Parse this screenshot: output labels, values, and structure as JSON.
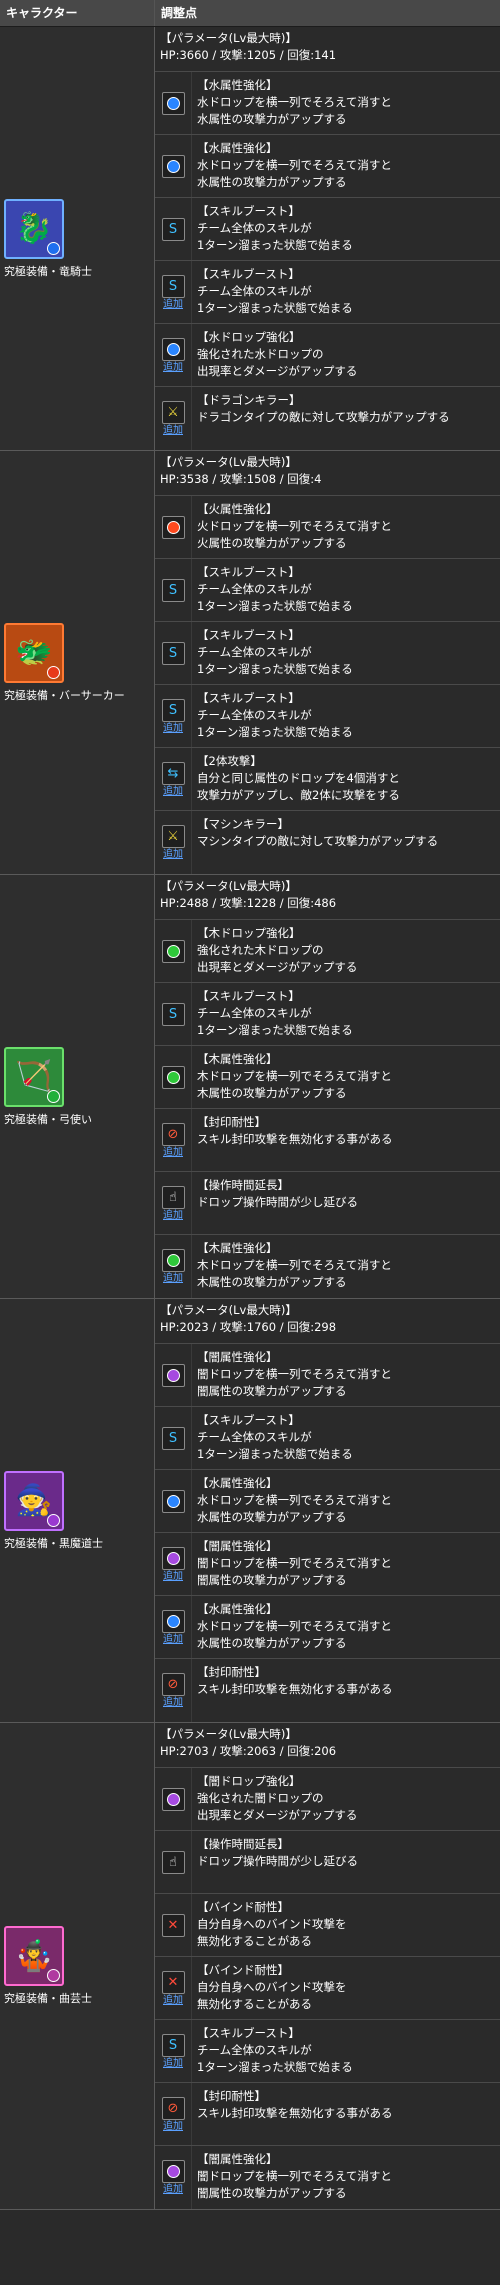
{
  "header": {
    "character_col": "キャラクター",
    "adjust_col": "調整点"
  },
  "add_label": "追加",
  "groups": [
    {
      "name": "究極装備・竜騎士",
      "avatar": {
        "bg": "#3a46b0",
        "border": "#6fb0ff",
        "glyph": "🐉",
        "orb": "#1e6ff0"
      },
      "param": {
        "title": "【パラメータ(Lv最大時)】",
        "stats": "HP:3660 / 攻撃:1205 / 回復:141"
      },
      "rows": [
        {
          "icon": "water-orb-icon",
          "kind": "orb",
          "color": "#2a85ff",
          "added": false,
          "title": "【水属性強化】",
          "lines": [
            "水ドロップを横一列でそろえて消すと",
            "水属性の攻撃力がアップする"
          ]
        },
        {
          "icon": "water-orb-icon",
          "kind": "orb",
          "color": "#2a85ff",
          "added": false,
          "title": "【水属性強化】",
          "lines": [
            "水ドロップを横一列でそろえて消すと",
            "水属性の攻撃力がアップする"
          ]
        },
        {
          "icon": "skill-boost-icon",
          "kind": "sym",
          "sym": "S",
          "color": "#3fc0ff",
          "added": false,
          "title": "【スキルブースト】",
          "lines": [
            "チーム全体のスキルが",
            "1ターン溜まった状態で始まる"
          ]
        },
        {
          "icon": "skill-boost-icon",
          "kind": "sym",
          "sym": "S",
          "color": "#3fc0ff",
          "added": true,
          "title": "【スキルブースト】",
          "lines": [
            "チーム全体のスキルが",
            "1ターン溜まった状態で始まる"
          ]
        },
        {
          "icon": "water-orb-plus-icon",
          "kind": "orb",
          "color": "#2a85ff",
          "added": true,
          "title": "【水ドロップ強化】",
          "lines": [
            "強化された水ドロップの",
            "出現率とダメージがアップする"
          ]
        },
        {
          "icon": "dragon-killer-icon",
          "kind": "sym",
          "sym": "⚔",
          "color": "#e8d23c",
          "added": true,
          "title": "【ドラゴンキラー】",
          "lines": [
            "ドラゴンタイプの敵に対して攻撃力がアップする"
          ]
        }
      ]
    },
    {
      "name": "究極装備・バーサーカー",
      "avatar": {
        "bg": "#b84a12",
        "border": "#ff7a33",
        "glyph": "🐲",
        "orb": "#e83a1a"
      },
      "param": {
        "title": "【パラメータ(Lv最大時)】",
        "stats": "HP:3538 / 攻撃:1508 / 回復:4"
      },
      "rows": [
        {
          "icon": "fire-orb-icon",
          "kind": "orb",
          "color": "#ff4a1f",
          "added": false,
          "title": "【火属性強化】",
          "lines": [
            "火ドロップを横一列でそろえて消すと",
            "火属性の攻撃力がアップする"
          ]
        },
        {
          "icon": "skill-boost-icon",
          "kind": "sym",
          "sym": "S",
          "color": "#3fc0ff",
          "added": false,
          "title": "【スキルブースト】",
          "lines": [
            "チーム全体のスキルが",
            "1ターン溜まった状態で始まる"
          ]
        },
        {
          "icon": "skill-boost-icon",
          "kind": "sym",
          "sym": "S",
          "color": "#3fc0ff",
          "added": false,
          "title": "【スキルブースト】",
          "lines": [
            "チーム全体のスキルが",
            "1ターン溜まった状態で始まる"
          ]
        },
        {
          "icon": "skill-boost-icon",
          "kind": "sym",
          "sym": "S",
          "color": "#3fc0ff",
          "added": true,
          "title": "【スキルブースト】",
          "lines": [
            "チーム全体のスキルが",
            "1ターン溜まった状態で始まる"
          ]
        },
        {
          "icon": "two-way-attack-icon",
          "kind": "sym",
          "sym": "⇆",
          "color": "#3fc0ff",
          "added": true,
          "title": "【2体攻撃】",
          "lines": [
            "自分と同じ属性のドロップを4個消すと",
            "攻撃力がアップし、敵2体に攻撃をする"
          ]
        },
        {
          "icon": "machine-killer-icon",
          "kind": "sym",
          "sym": "⚔",
          "color": "#e8d23c",
          "added": true,
          "title": "【マシンキラー】",
          "lines": [
            "マシンタイプの敵に対して攻撃力がアップする"
          ]
        }
      ]
    },
    {
      "name": "究極装備・弓使い",
      "avatar": {
        "bg": "#2d8a3a",
        "border": "#6be06b",
        "glyph": "🏹",
        "orb": "#22b03a"
      },
      "param": {
        "title": "【パラメータ(Lv最大時)】",
        "stats": "HP:2488 / 攻撃:1228 / 回復:486"
      },
      "rows": [
        {
          "icon": "wood-orb-plus-icon",
          "kind": "orb",
          "color": "#2fc83a",
          "added": false,
          "title": "【木ドロップ強化】",
          "lines": [
            "強化された木ドロップの",
            "出現率とダメージがアップする"
          ]
        },
        {
          "icon": "skill-boost-icon",
          "kind": "sym",
          "sym": "S",
          "color": "#3fc0ff",
          "added": false,
          "title": "【スキルブースト】",
          "lines": [
            "チーム全体のスキルが",
            "1ターン溜まった状態で始まる"
          ]
        },
        {
          "icon": "wood-orb-icon",
          "kind": "orb",
          "color": "#2fc83a",
          "added": false,
          "title": "【木属性強化】",
          "lines": [
            "木ドロップを横一列でそろえて消すと",
            "木属性の攻撃力がアップする"
          ]
        },
        {
          "icon": "skill-bind-resist-icon",
          "kind": "sym",
          "sym": "⊘",
          "color": "#ff5a3a",
          "added": true,
          "title": "【封印耐性】",
          "lines": [
            "スキル封印攻撃を無効化する事がある"
          ]
        },
        {
          "icon": "time-extend-icon",
          "kind": "sym",
          "sym": "☝",
          "color": "#ffffff",
          "added": true,
          "title": "【操作時間延長】",
          "lines": [
            "ドロップ操作時間が少し延びる"
          ]
        },
        {
          "icon": "wood-orb-icon",
          "kind": "orb",
          "color": "#2fc83a",
          "added": true,
          "title": "【木属性強化】",
          "lines": [
            "木ドロップを横一列でそろえて消すと",
            "木属性の攻撃力がアップする"
          ]
        }
      ]
    },
    {
      "name": "究極装備・黒魔道士",
      "avatar": {
        "bg": "#6a2a8a",
        "border": "#c070ff",
        "glyph": "🧙",
        "orb": "#9a3ad0"
      },
      "param": {
        "title": "【パラメータ(Lv最大時)】",
        "stats": "HP:2023 / 攻撃:1760 / 回復:298"
      },
      "rows": [
        {
          "icon": "dark-orb-icon",
          "kind": "orb",
          "color": "#a64ae0",
          "added": false,
          "title": "【闇属性強化】",
          "lines": [
            "闇ドロップを横一列でそろえて消すと",
            "闇属性の攻撃力がアップする"
          ]
        },
        {
          "icon": "skill-boost-icon",
          "kind": "sym",
          "sym": "S",
          "color": "#3fc0ff",
          "added": false,
          "title": "【スキルブースト】",
          "lines": [
            "チーム全体のスキルが",
            "1ターン溜まった状態で始まる"
          ]
        },
        {
          "icon": "water-orb-icon",
          "kind": "orb",
          "color": "#2a85ff",
          "added": false,
          "title": "【水属性強化】",
          "lines": [
            "水ドロップを横一列でそろえて消すと",
            "水属性の攻撃力がアップする"
          ]
        },
        {
          "icon": "dark-orb-icon",
          "kind": "orb",
          "color": "#a64ae0",
          "added": true,
          "title": "【闇属性強化】",
          "lines": [
            "闇ドロップを横一列でそろえて消すと",
            "闇属性の攻撃力がアップする"
          ]
        },
        {
          "icon": "water-orb-icon",
          "kind": "orb",
          "color": "#2a85ff",
          "added": true,
          "title": "【水属性強化】",
          "lines": [
            "水ドロップを横一列でそろえて消すと",
            "水属性の攻撃力がアップする"
          ]
        },
        {
          "icon": "skill-bind-resist-icon",
          "kind": "sym",
          "sym": "⊘",
          "color": "#ff5a3a",
          "added": true,
          "title": "【封印耐性】",
          "lines": [
            "スキル封印攻撃を無効化する事がある"
          ]
        }
      ]
    },
    {
      "name": "究極装備・曲芸士",
      "avatar": {
        "bg": "#7a2a6a",
        "border": "#ff6ad0",
        "glyph": "🤹",
        "orb": "#b03aa0"
      },
      "param": {
        "title": "【パラメータ(Lv最大時)】",
        "stats": "HP:2703 / 攻撃:2063 / 回復:206"
      },
      "rows": [
        {
          "icon": "dark-orb-plus-icon",
          "kind": "orb",
          "color": "#a64ae0",
          "added": false,
          "title": "【闇ドロップ強化】",
          "lines": [
            "強化された闇ドロップの",
            "出現率とダメージがアップする"
          ]
        },
        {
          "icon": "time-extend-icon",
          "kind": "sym",
          "sym": "☝",
          "color": "#ffffff",
          "added": false,
          "title": "【操作時間延長】",
          "lines": [
            "ドロップ操作時間が少し延びる"
          ]
        },
        {
          "icon": "bind-resist-icon",
          "kind": "sym",
          "sym": "✕",
          "color": "#ff4a3a",
          "added": false,
          "title": "【バインド耐性】",
          "lines": [
            "自分自身へのバインド攻撃を",
            "無効化することがある"
          ]
        },
        {
          "icon": "bind-resist-icon",
          "kind": "sym",
          "sym": "✕",
          "color": "#ff4a3a",
          "added": true,
          "title": "【バインド耐性】",
          "lines": [
            "自分自身へのバインド攻撃を",
            "無効化することがある"
          ]
        },
        {
          "icon": "skill-boost-icon",
          "kind": "sym",
          "sym": "S",
          "color": "#3fc0ff",
          "added": true,
          "title": "【スキルブースト】",
          "lines": [
            "チーム全体のスキルが",
            "1ターン溜まった状態で始まる"
          ]
        },
        {
          "icon": "skill-bind-resist-icon",
          "kind": "sym",
          "sym": "⊘",
          "color": "#ff5a3a",
          "added": true,
          "title": "【封印耐性】",
          "lines": [
            "スキル封印攻撃を無効化する事がある"
          ]
        },
        {
          "icon": "dark-orb-icon",
          "kind": "orb",
          "color": "#a64ae0",
          "added": true,
          "title": "【闇属性強化】",
          "lines": [
            "闇ドロップを横一列でそろえて消すと",
            "闇属性の攻撃力がアップする"
          ]
        }
      ]
    }
  ]
}
